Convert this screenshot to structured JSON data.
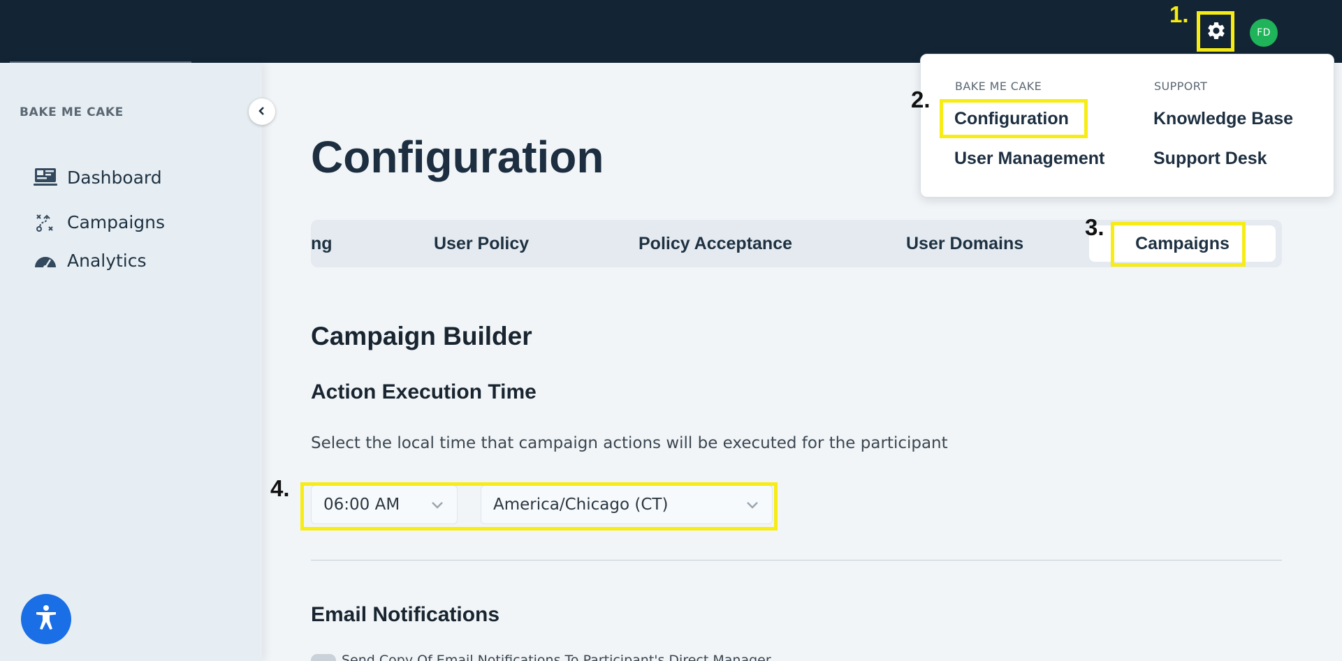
{
  "header": {
    "avatar_initials": "FD",
    "settings_icon": "gear-icon"
  },
  "steps": {
    "one": "1.",
    "two": "2.",
    "three": "3.",
    "four": "4."
  },
  "sidebar": {
    "org_name": "BAKE ME CAKE",
    "items": [
      {
        "label": "Dashboard",
        "icon": "dashboard-icon"
      },
      {
        "label": "Campaigns",
        "icon": "campaigns-icon"
      },
      {
        "label": "Analytics",
        "icon": "analytics-icon"
      }
    ]
  },
  "settings_menu": {
    "col1_heading": "BAKE ME CAKE",
    "col1_items": [
      "Configuration",
      "User Management"
    ],
    "col2_heading": "SUPPORT",
    "col2_items": [
      "Knowledge Base",
      "Support Desk"
    ]
  },
  "main": {
    "title": "Configuration",
    "tabs": [
      {
        "label": "ng"
      },
      {
        "label": "User Policy"
      },
      {
        "label": "Policy Acceptance"
      },
      {
        "label": "User Domains"
      },
      {
        "label": "Campaigns",
        "active": true
      }
    ],
    "section_title": "Campaign Builder",
    "subsection_title": "Action Execution Time",
    "description": "Select the local time that campaign actions will be executed for the participant",
    "time_select": "06:00 AM",
    "timezone_select": "America/Chicago (CT)",
    "email_section_title": "Email Notifications",
    "toggle_label": "Send Copy Of Email Notifications To Participant's Direct Manager"
  },
  "colors": {
    "topbar": "#132435",
    "highlight": "#f7ec13",
    "avatar": "#1fb35a",
    "accessibility": "#1a6ee6"
  }
}
